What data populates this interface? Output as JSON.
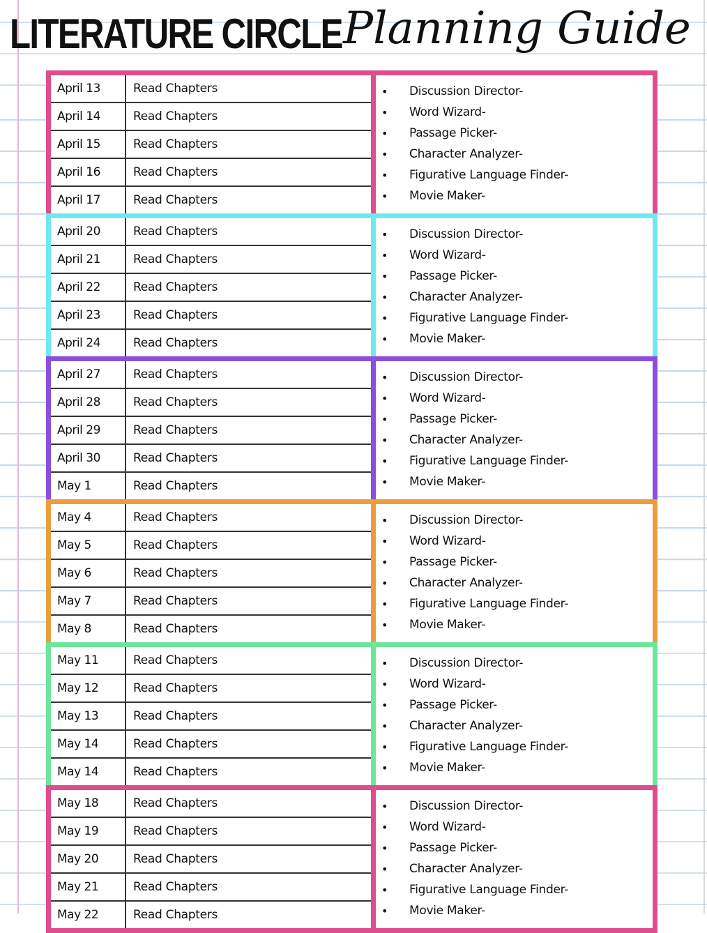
{
  "title": {
    "block_text": "LITERATURE CIRCLE",
    "script_text": "Planning Guide"
  },
  "roles": [
    "Discussion Director-",
    "Word Wizard-",
    "Passage Picker-",
    "Character Analyzer-",
    "Figurative Language Finder-",
    "Movie Maker-"
  ],
  "bullet_glyph": "•",
  "weeks": [
    {
      "color": "#df4d8f",
      "days": [
        {
          "date": "April 13",
          "task": "Read Chapters"
        },
        {
          "date": "April 14",
          "task": "Read Chapters"
        },
        {
          "date": "April 15",
          "task": "Read Chapters"
        },
        {
          "date": "April 16",
          "task": "Read Chapters"
        },
        {
          "date": "April 17",
          "task": "Read Chapters"
        }
      ]
    },
    {
      "color": "#6eeaee",
      "days": [
        {
          "date": "April 20",
          "task": "Read Chapters"
        },
        {
          "date": "April 21",
          "task": "Read Chapters"
        },
        {
          "date": "April 22",
          "task": "Read Chapters"
        },
        {
          "date": "April 23",
          "task": "Read Chapters"
        },
        {
          "date": "April 24",
          "task": "Read Chapters"
        }
      ]
    },
    {
      "color": "#8a4fdd",
      "days": [
        {
          "date": "April 27",
          "task": "Read Chapters"
        },
        {
          "date": "April 28",
          "task": "Read Chapters"
        },
        {
          "date": "April 29",
          "task": "Read Chapters"
        },
        {
          "date": "April 30",
          "task": "Read Chapters"
        },
        {
          "date": "May 1",
          "task": "Read Chapters"
        }
      ]
    },
    {
      "color": "#ec9d3d",
      "days": [
        {
          "date": "May 4",
          "task": "Read Chapters"
        },
        {
          "date": "May 5",
          "task": "Read Chapters"
        },
        {
          "date": "May 6",
          "task": "Read Chapters"
        },
        {
          "date": "May 7",
          "task": "Read Chapters"
        },
        {
          "date": "May 8",
          "task": "Read Chapters"
        }
      ]
    },
    {
      "color": "#6ee59d",
      "days": [
        {
          "date": "May 11",
          "task": "Read Chapters"
        },
        {
          "date": "May 12",
          "task": "Read Chapters"
        },
        {
          "date": "May 13",
          "task": "Read Chapters"
        },
        {
          "date": "May 14",
          "task": "Read Chapters"
        },
        {
          "date": "May 14",
          "task": "Read Chapters"
        }
      ]
    },
    {
      "color": "#df4d8f",
      "days": [
        {
          "date": "May 18",
          "task": "Read Chapters"
        },
        {
          "date": "May 19",
          "task": "Read Chapters"
        },
        {
          "date": "May 20",
          "task": "Read Chapters"
        },
        {
          "date": "May 21",
          "task": "Read Chapters"
        },
        {
          "date": "May 22",
          "task": "Read Chapters"
        }
      ]
    }
  ]
}
